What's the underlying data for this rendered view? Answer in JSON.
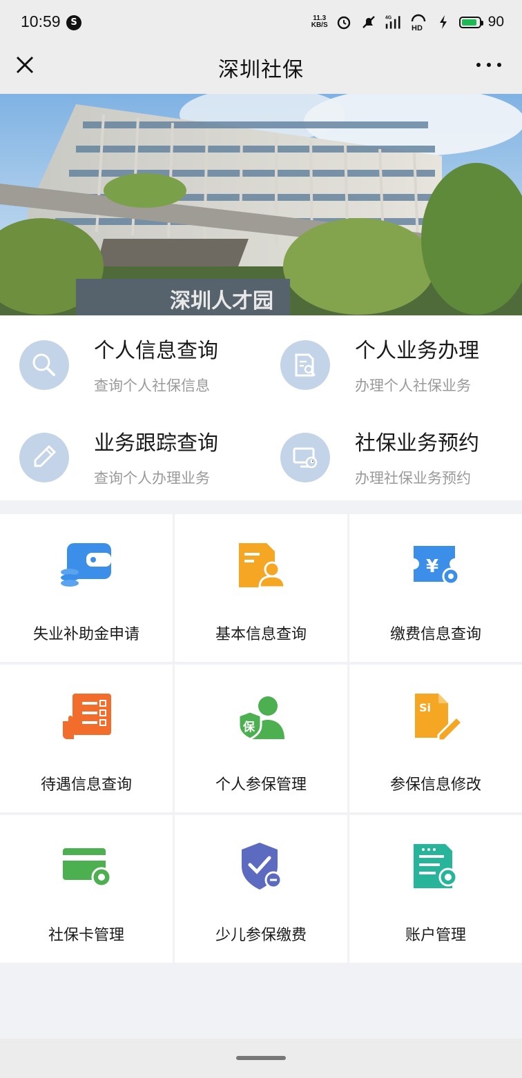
{
  "status_bar": {
    "time": "10:59",
    "notification_icon": "s-circle-icon",
    "net_speed_value": "11.3",
    "net_speed_unit": "KB/S",
    "battery_level": "90",
    "battery_fraction": 0.9,
    "icons": [
      "alarm-icon",
      "mute-icon",
      "4g-signal-icon",
      "hd-icon",
      "charging-icon",
      "battery-icon"
    ]
  },
  "nav_bar": {
    "title": "深圳社保",
    "close_icon": "close-icon",
    "more_icon": "more-dots-icon"
  },
  "banner": {
    "sign_text": "深圳人才园",
    "description": "photo"
  },
  "quick_services": [
    {
      "title": "个人信息查询",
      "subtitle": "查询个人社保信息",
      "icon": "search-icon"
    },
    {
      "title": "个人业务办理",
      "subtitle": "办理个人社保业务",
      "icon": "document-search-icon"
    },
    {
      "title": "业务跟踪查询",
      "subtitle": "查询个人办理业务",
      "icon": "pen-icon"
    },
    {
      "title": "社保业务预约",
      "subtitle": "办理社保业务预约",
      "icon": "monitor-clock-icon"
    }
  ],
  "services": [
    {
      "label": "失业补助金申请",
      "icon": "wallet-coins-icon",
      "color": "#3b8fe8"
    },
    {
      "label": "基本信息查询",
      "icon": "user-document-icon",
      "color": "#f5a623"
    },
    {
      "label": "缴费信息查询",
      "icon": "yen-ticket-icon",
      "color": "#3b8fe8"
    },
    {
      "label": "待遇信息查询",
      "icon": "checklist-hand-icon",
      "color": "#f26d2b"
    },
    {
      "label": "个人参保管理",
      "icon": "insured-person-icon",
      "color": "#4caf50"
    },
    {
      "label": "参保信息修改",
      "icon": "si-edit-icon",
      "color": "#f5a623"
    },
    {
      "label": "社保卡管理",
      "icon": "card-gear-icon",
      "color": "#4caf50"
    },
    {
      "label": "少儿参保缴费",
      "icon": "shield-check-icon",
      "color": "#5c6bc0"
    },
    {
      "label": "账户管理",
      "icon": "account-gear-icon",
      "color": "#26b59a"
    }
  ],
  "shield_badge_text": "保",
  "si_badge_text": "Si",
  "yen_symbol": "¥"
}
